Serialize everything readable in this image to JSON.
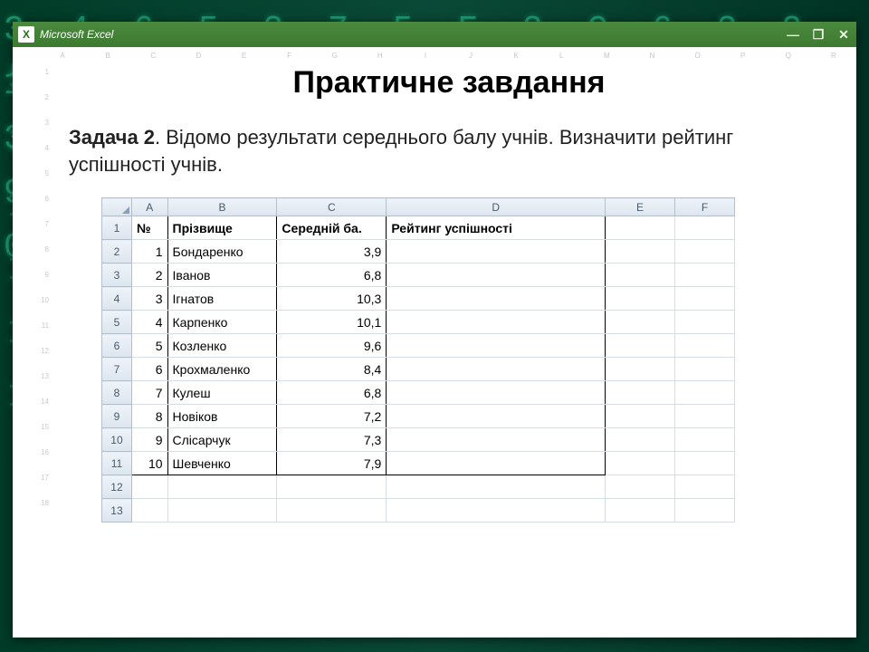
{
  "app": {
    "name": "Microsoft Excel"
  },
  "window_controls": {
    "minimize": "—",
    "maximize": "❐",
    "close": "✕"
  },
  "slide": {
    "title": "Практичне завдання",
    "task_label": "Задача 2",
    "task_text": ". Відомо результати середнього балу учнів. Визначити рейтинг успішності учнів."
  },
  "bg_columns": [
    "A",
    "B",
    "C",
    "D",
    "E",
    "F",
    "G",
    "H",
    "I",
    "J",
    "K",
    "L",
    "M",
    "N",
    "O",
    "P",
    "Q",
    "R"
  ],
  "bg_rows": [
    "1",
    "2",
    "3",
    "4",
    "5",
    "6",
    "7",
    "8",
    "9",
    "10",
    "11",
    "12",
    "13",
    "14",
    "15",
    "16",
    "17",
    "18"
  ],
  "sheet": {
    "col_letters": [
      "A",
      "B",
      "C",
      "D",
      "E",
      "F"
    ],
    "row_numbers": [
      "1",
      "2",
      "3",
      "4",
      "5",
      "6",
      "7",
      "8",
      "9",
      "10",
      "11",
      "12",
      "13"
    ],
    "headers": {
      "A": "№",
      "B": "Прізвище",
      "C": "Середній ба.",
      "D": "Рейтинг успішності"
    },
    "rows": [
      {
        "num": "1",
        "name": "Бондаренко",
        "avg": "3,9",
        "rank": ""
      },
      {
        "num": "2",
        "name": "Іванов",
        "avg": "6,8",
        "rank": ""
      },
      {
        "num": "3",
        "name": "Ігнатов",
        "avg": "10,3",
        "rank": ""
      },
      {
        "num": "4",
        "name": "Карпенко",
        "avg": "10,1",
        "rank": ""
      },
      {
        "num": "5",
        "name": "Козленко",
        "avg": "9,6",
        "rank": ""
      },
      {
        "num": "6",
        "name": "Крохмаленко",
        "avg": "8,4",
        "rank": ""
      },
      {
        "num": "7",
        "name": "Кулеш",
        "avg": "6,8",
        "rank": ""
      },
      {
        "num": "8",
        "name": "Новіков",
        "avg": "7,2",
        "rank": ""
      },
      {
        "num": "9",
        "name": "Слісарчук",
        "avg": "7,3",
        "rank": ""
      },
      {
        "num": "10",
        "name": "Шевченко",
        "avg": "7,9",
        "rank": ""
      }
    ]
  }
}
